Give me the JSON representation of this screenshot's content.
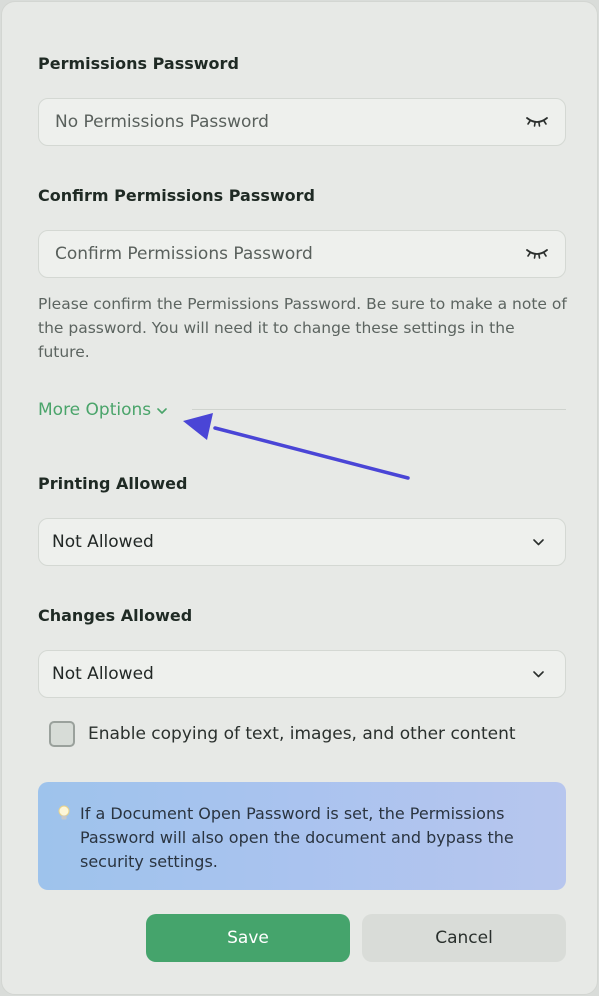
{
  "permissions_password": {
    "label": "Permissions Password",
    "placeholder": "No Permissions Password",
    "toggle_icon": "eye-closed-icon"
  },
  "confirm_password": {
    "label": "Confirm Permissions Password",
    "placeholder": "Confirm Permissions Password",
    "toggle_icon": "eye-closed-icon",
    "hint": "Please confirm the Permissions Password. Be sure to make a note of the password. You will need it to change these settings in the future."
  },
  "more_options": {
    "label": "More Options",
    "icon": "chevron-down-icon"
  },
  "printing": {
    "label": "Printing Allowed",
    "value": "Not Allowed"
  },
  "changes": {
    "label": "Changes Allowed",
    "value": "Not Allowed"
  },
  "copy_checkbox": {
    "label": "Enable copying of text, images, and other content",
    "checked": false
  },
  "info_note": {
    "icon": "lightbulb-icon",
    "text": "If a Document Open Password is set, the Permissions Password will also open the document and bypass the security settings."
  },
  "buttons": {
    "save": "Save",
    "cancel": "Cancel"
  },
  "colors": {
    "accent": "#45a46c",
    "link": "#4aa46a",
    "annotation_arrow": "#4a45d6",
    "info_bg": "#aac3ef"
  }
}
